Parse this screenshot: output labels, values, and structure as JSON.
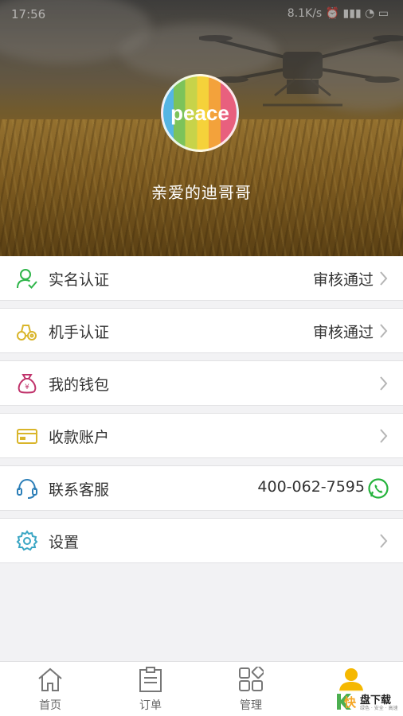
{
  "status_bar": {
    "time": "17:56",
    "right": "8.1K/s ⏰ ▮▮▮ ◔ ▭"
  },
  "profile": {
    "avatar_text": "peace",
    "username": "亲爱的迪哥哥"
  },
  "menu": [
    {
      "key": "real_name",
      "label": "实名认证",
      "value": "审核通过",
      "icon": "person-check-icon",
      "color": "#2fb54a"
    },
    {
      "key": "operator",
      "label": "机手认证",
      "value": "审核通过",
      "icon": "tractor-icon",
      "color": "#d9b52a"
    },
    {
      "key": "wallet",
      "label": "我的钱包",
      "value": "",
      "icon": "money-bag-icon",
      "color": "#c0336b"
    },
    {
      "key": "account",
      "label": "收款账户",
      "value": "",
      "icon": "bank-card-icon",
      "color": "#d9b52a"
    },
    {
      "key": "service",
      "label": "联系客服",
      "value": "400-062-7595",
      "icon": "headset-icon",
      "color": "#2d7fb8"
    },
    {
      "key": "settings",
      "label": "设置",
      "value": "",
      "icon": "gear-icon",
      "color": "#3aa6c4"
    }
  ],
  "tabs": [
    {
      "label": "首页",
      "icon": "home-icon"
    },
    {
      "label": "订单",
      "icon": "clipboard-icon"
    },
    {
      "label": "管理",
      "icon": "grid-icon"
    },
    {
      "label": "",
      "icon": "user-icon",
      "active": true
    }
  ],
  "watermark": {
    "k": "K",
    "kuai": "快",
    "main": "盘下载",
    "sub": "绿色 · 安全 · 高速"
  },
  "colors": {
    "accent": "#f5b800",
    "whatsapp": "#25b33c"
  }
}
